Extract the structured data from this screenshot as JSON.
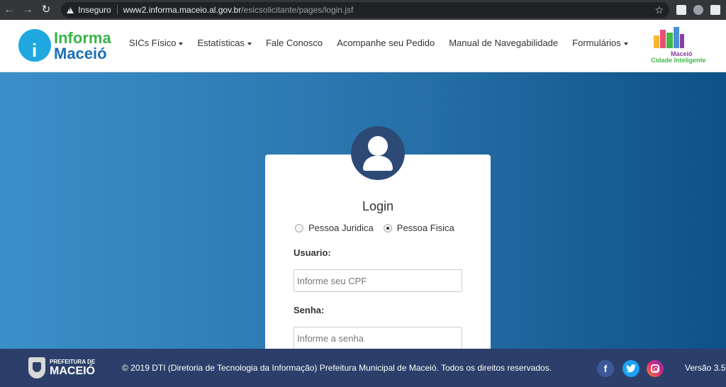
{
  "browser": {
    "insecure_label": "Inseguro",
    "url_host": "www2.informa.maceio.al.gov.br",
    "url_path": "/esicsolicitante/pages/login.jsf"
  },
  "header": {
    "logo_line1": "Informa",
    "logo_line2": "Maceió",
    "menu": {
      "sics": "SICs Físico",
      "estatisticas": "Estatísticas",
      "fale": "Fale Conosco",
      "acompanhe": "Acompanhe seu Pedido",
      "manual": "Manual de Navegabilidade",
      "formularios": "Formulários"
    },
    "city_logo_line1": "Maceió",
    "city_logo_line2": "Cidade Inteligente"
  },
  "login": {
    "title": "Login",
    "radio_juridica": "Pessoa Juridica",
    "radio_fisica": "Pessoa Fisica",
    "selected": "Pessoa Fisica",
    "usuario_label": "Usuario:",
    "usuario_placeholder": "Informe seu CPF",
    "senha_label": "Senha:",
    "senha_placeholder": "Informe a senha"
  },
  "footer": {
    "pm_line1": "PREFEITURA DE",
    "pm_line2": "MACEIÓ",
    "copyright": "© 2019 DTI (Diretoria de Tecnologia da Informação) Prefeitura Municipal de Maceió. Todos os direitos reservados.",
    "version": "Versão 3.5"
  },
  "colors": {
    "brand_green": "#39b54a",
    "brand_blue": "#1a6fb5",
    "avatar_bg": "#2c4a75",
    "footer_bg": "#2b3f6a"
  }
}
